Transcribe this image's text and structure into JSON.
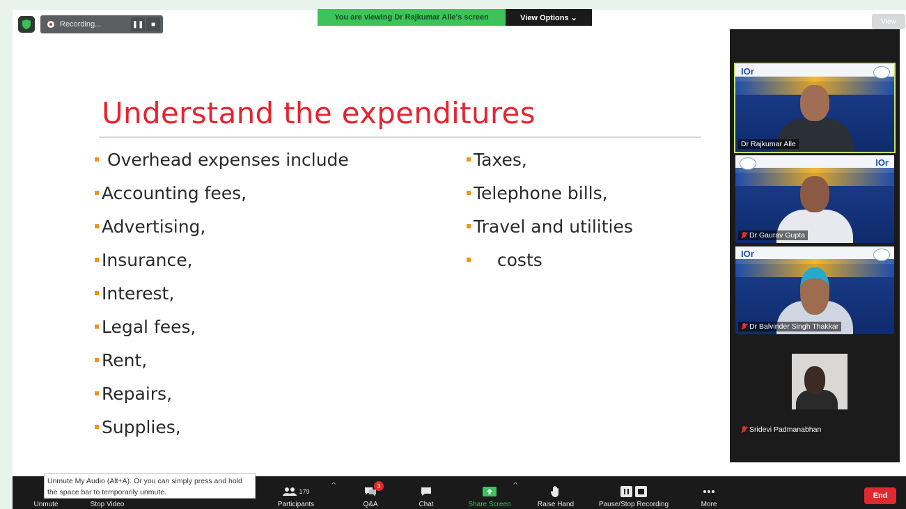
{
  "recording": {
    "label": "Recording...",
    "pause": "❚❚",
    "stop": "■"
  },
  "share_banner": {
    "viewing": "You are viewing Dr Rajkumar Alle's screen",
    "options": "View Options ⌄"
  },
  "view_button": "View",
  "slide": {
    "title": "Understand the expenditures",
    "left_items": [
      " Overhead expenses include",
      "Accounting fees,",
      "Advertising,",
      "Insurance,",
      "Interest,",
      "Legal fees,",
      "Rent,",
      "Repairs,",
      "Supplies,"
    ],
    "right_items": [
      "Taxes,",
      "Telephone bills,",
      "Travel and utilities",
      "  costs"
    ],
    "bullet_color": "#f39218",
    "title_color": "#e8232f"
  },
  "participants_gallery": [
    {
      "name": "Dr Rajkumar Alle",
      "muted": false,
      "active": true
    },
    {
      "name": "Dr Gaurav Gupta",
      "muted": true,
      "active": false
    },
    {
      "name": "Dr Balvinder Singh Thakkar",
      "muted": true,
      "active": false
    },
    {
      "name": "Sridevi Padmanabhan",
      "muted": true,
      "active": false
    }
  ],
  "tile_logo": "IOr",
  "tooltip": "Unmute My Audio (Alt+A). Or you can simply press and hold the space bar to temporarily unmute.",
  "toolbar": {
    "unmute": "Unmute",
    "stop_video": "Stop Video",
    "participants": "Participants",
    "participants_count": "179",
    "qa": "Q&A",
    "qa_badge": "3",
    "chat": "Chat",
    "share_screen": "Share Screen",
    "raise_hand": "Raise Hand",
    "pause_stop_recording": "Pause/Stop Recording",
    "more": "More",
    "end": "End"
  }
}
